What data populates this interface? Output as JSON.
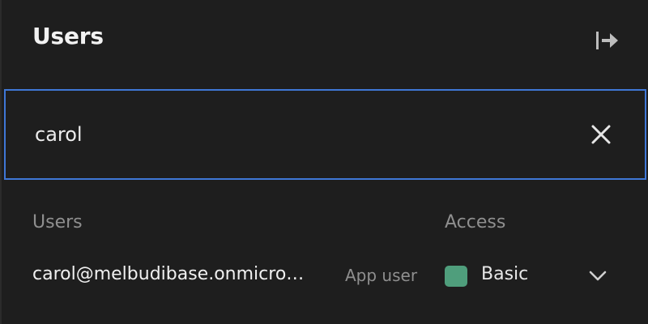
{
  "header": {
    "title": "Users",
    "collapse_icon": "exit-panel-icon"
  },
  "search": {
    "value": "carol",
    "clear_icon": "close-icon"
  },
  "table": {
    "columns": [
      "Users",
      "Access"
    ],
    "rows": [
      {
        "email": "carol@melbudibase.onmicro…",
        "role": "App user",
        "access": "Basic",
        "access_color": "#4f9e7c"
      }
    ]
  },
  "colors": {
    "background": "#1e1e1e",
    "focus_border": "#3f77d6"
  }
}
